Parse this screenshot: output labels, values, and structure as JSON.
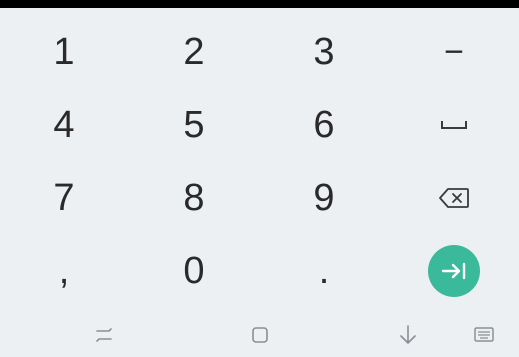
{
  "keyboard": {
    "keys": {
      "k1": "1",
      "k2": "2",
      "k3": "3",
      "minus": "−",
      "k4": "4",
      "k5": "5",
      "k6": "6",
      "k7": "7",
      "k8": "8",
      "k9": "9",
      "comma": ",",
      "k0": "0",
      "period": "."
    },
    "icons": {
      "space": "space-icon",
      "backspace": "backspace-icon",
      "enter": "tab-next-icon"
    },
    "accent_color": "#3bb99b",
    "background_color": "#edf0f2",
    "key_text_color": "#2a2a2a"
  },
  "navigation_bar": {
    "buttons": [
      "recent-apps-icon",
      "home-icon",
      "hide-keyboard-icon",
      "keyboard-switch-icon"
    ],
    "icon_color": "#8a8f94"
  }
}
